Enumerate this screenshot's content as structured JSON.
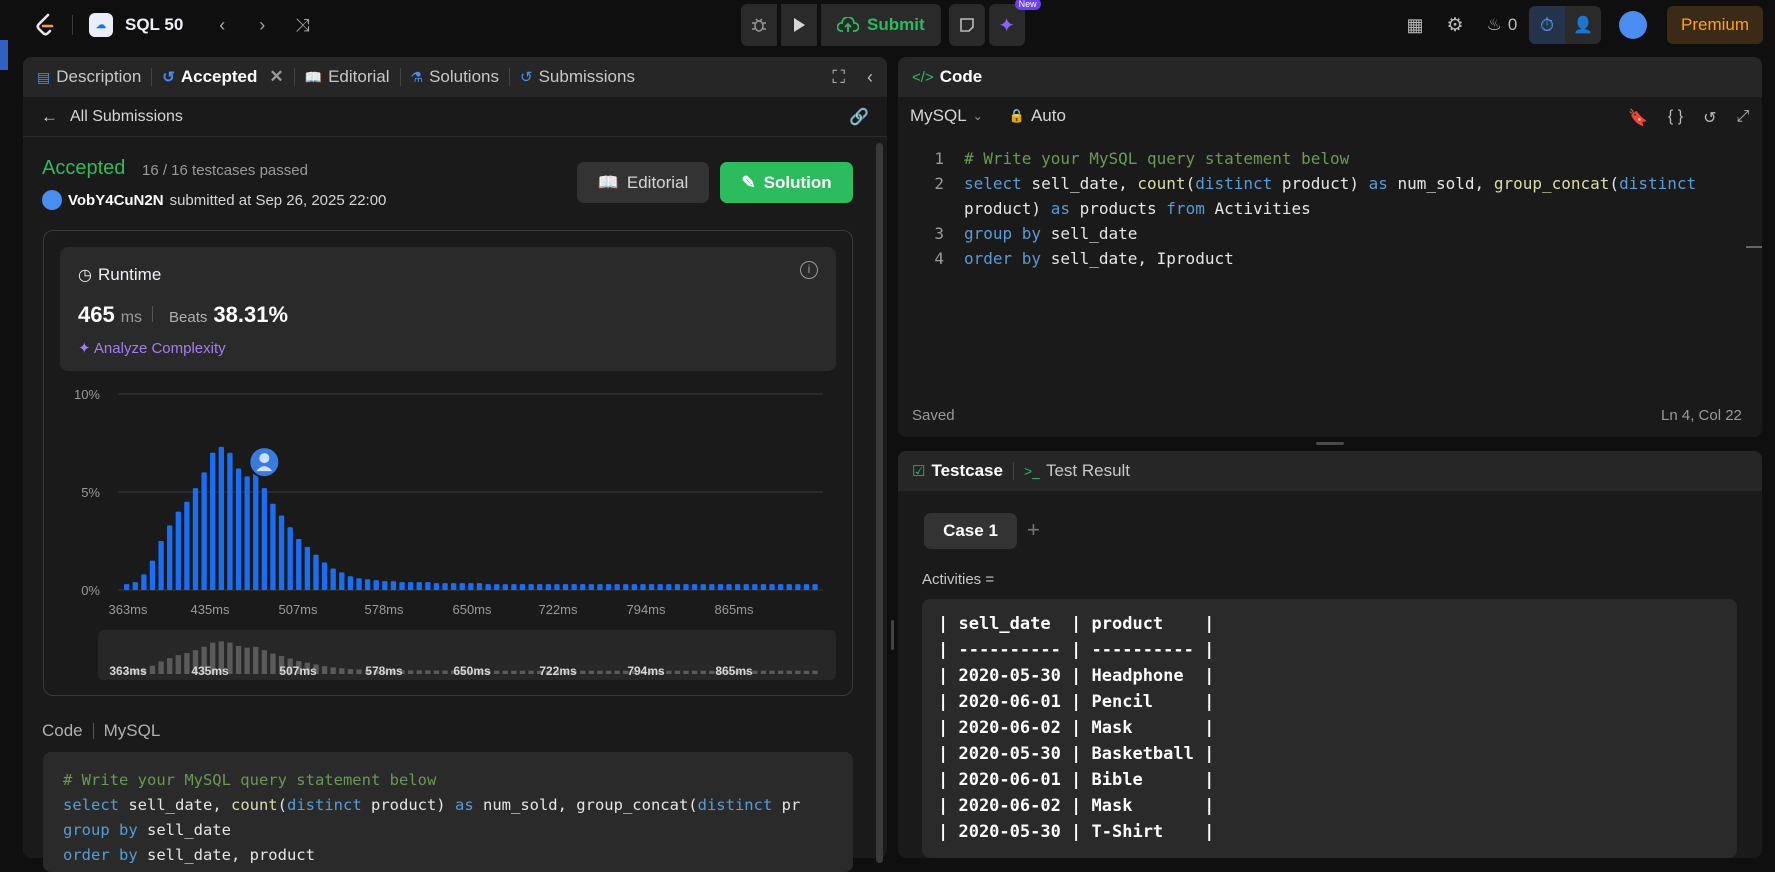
{
  "topbar": {
    "title": "SQL 50",
    "submit_label": "Submit",
    "new_badge": "New",
    "streak_count": "0",
    "premium_label": "Premium"
  },
  "left_panel": {
    "tabs": [
      {
        "label": "Description"
      },
      {
        "label": "Accepted"
      },
      {
        "label": "Editorial"
      },
      {
        "label": "Solutions"
      },
      {
        "label": "Submissions"
      }
    ],
    "back_label": "All Submissions",
    "status": "Accepted",
    "testcases": "16 / 16 testcases passed",
    "username": "VobY4CuN2N",
    "submitted_text": "submitted at Sep 26, 2025 22:00",
    "editorial_button": "Editorial",
    "solution_button": "Solution",
    "runtime": {
      "title": "Runtime",
      "value": "465",
      "unit": "ms",
      "beats_label": "Beats",
      "beats_value": "38.31%",
      "analyze_label": "Analyze Complexity"
    },
    "code_label": "Code",
    "code_lang": "MySQL",
    "code_lines": [
      [
        {
          "c": "cm",
          "t": "# Write your MySQL query statement below"
        }
      ],
      [
        {
          "c": "kw",
          "t": "select"
        },
        {
          "c": "tx",
          "t": " sell_date, "
        },
        {
          "c": "fn",
          "t": "count"
        },
        {
          "c": "tx",
          "t": "("
        },
        {
          "c": "kw",
          "t": "distinct"
        },
        {
          "c": "tx",
          "t": " product) "
        },
        {
          "c": "kw",
          "t": "as"
        },
        {
          "c": "tx",
          "t": " num_sold, group_concat("
        },
        {
          "c": "kw",
          "t": "distinct"
        },
        {
          "c": "tx",
          "t": " pr"
        }
      ],
      [
        {
          "c": "kw",
          "t": "group by"
        },
        {
          "c": "tx",
          "t": " sell_date"
        }
      ],
      [
        {
          "c": "kw",
          "t": "order by"
        },
        {
          "c": "tx",
          "t": " sell_date, product"
        }
      ]
    ]
  },
  "chart_data": {
    "type": "bar",
    "y_ticks": [
      "10%",
      "5%",
      "0%"
    ],
    "x_ticks": [
      "363ms",
      "435ms",
      "507ms",
      "578ms",
      "650ms",
      "722ms",
      "794ms",
      "865ms"
    ],
    "ylim": [
      0,
      10
    ],
    "values": [
      0.3,
      0.4,
      0.8,
      1.5,
      2.5,
      3.3,
      4.0,
      4.5,
      5.2,
      6.0,
      7.0,
      7.3,
      7.0,
      6.2,
      5.8,
      6.0,
      5.2,
      4.4,
      3.8,
      3.2,
      2.6,
      2.2,
      1.8,
      1.4,
      1.1,
      0.9,
      0.7,
      0.6,
      0.55,
      0.5,
      0.45,
      0.45,
      0.4,
      0.4,
      0.4,
      0.4,
      0.35,
      0.35,
      0.35,
      0.35,
      0.35,
      0.35,
      0.3,
      0.3,
      0.3,
      0.3,
      0.3,
      0.3,
      0.3,
      0.3,
      0.3,
      0.3,
      0.3,
      0.3,
      0.3,
      0.3,
      0.3,
      0.3,
      0.3,
      0.3,
      0.3,
      0.3,
      0.3,
      0.3,
      0.3,
      0.3,
      0.3,
      0.3,
      0.3,
      0.3,
      0.3,
      0.3,
      0.3,
      0.3,
      0.3,
      0.3,
      0.3,
      0.3,
      0.3,
      0.3,
      0.3
    ],
    "highlight_x": "465ms",
    "bar_color": "#1a6ef5"
  },
  "right_panel": {
    "code_tab": "Code",
    "language": "MySQL",
    "mode": "Auto",
    "line_numbers": [
      "1",
      "2",
      "",
      "3",
      "4"
    ],
    "lines": [
      [
        {
          "c": "cm",
          "t": "# Write your MySQL query statement below"
        }
      ],
      [
        {
          "c": "kw",
          "t": "select"
        },
        {
          "c": "tx",
          "t": " sell_date, "
        },
        {
          "c": "fn",
          "t": "count"
        },
        {
          "c": "tx",
          "t": "("
        },
        {
          "c": "kw",
          "t": "distinct"
        },
        {
          "c": "tx",
          "t": " product) "
        },
        {
          "c": "kw",
          "t": "as"
        },
        {
          "c": "tx",
          "t": " num_sold, "
        },
        {
          "c": "fn",
          "t": "group_concat"
        },
        {
          "c": "tx",
          "t": "("
        },
        {
          "c": "kw",
          "t": "distinct"
        }
      ],
      [
        {
          "c": "tx",
          "t": "product) "
        },
        {
          "c": "kw",
          "t": "as"
        },
        {
          "c": "tx",
          "t": " products "
        },
        {
          "c": "kw",
          "t": "from"
        },
        {
          "c": "tx",
          "t": " Activities"
        }
      ],
      [
        {
          "c": "kw",
          "t": "group by"
        },
        {
          "c": "tx",
          "t": " sell_date"
        }
      ],
      [
        {
          "c": "kw",
          "t": "order by"
        },
        {
          "c": "tx",
          "t": " sell_date, "
        },
        {
          "c": "tx",
          "t": "Iproduct"
        }
      ]
    ],
    "saved": "Saved",
    "cursor_pos": "Ln 4, Col 22",
    "testcase_tab": "Testcase",
    "testresult_tab": "Test Result",
    "case_label": "Case 1",
    "table_label": "Activities =",
    "table_text": "| sell_date  | product    |\n| ---------- | ---------- |\n| 2020-05-30 | Headphone  |\n| 2020-06-01 | Pencil     |\n| 2020-06-02 | Mask       |\n| 2020-05-30 | Basketball |\n| 2020-06-01 | Bible      |\n| 2020-06-02 | Mask       |\n| 2020-05-30 | T-Shirt    |"
  }
}
